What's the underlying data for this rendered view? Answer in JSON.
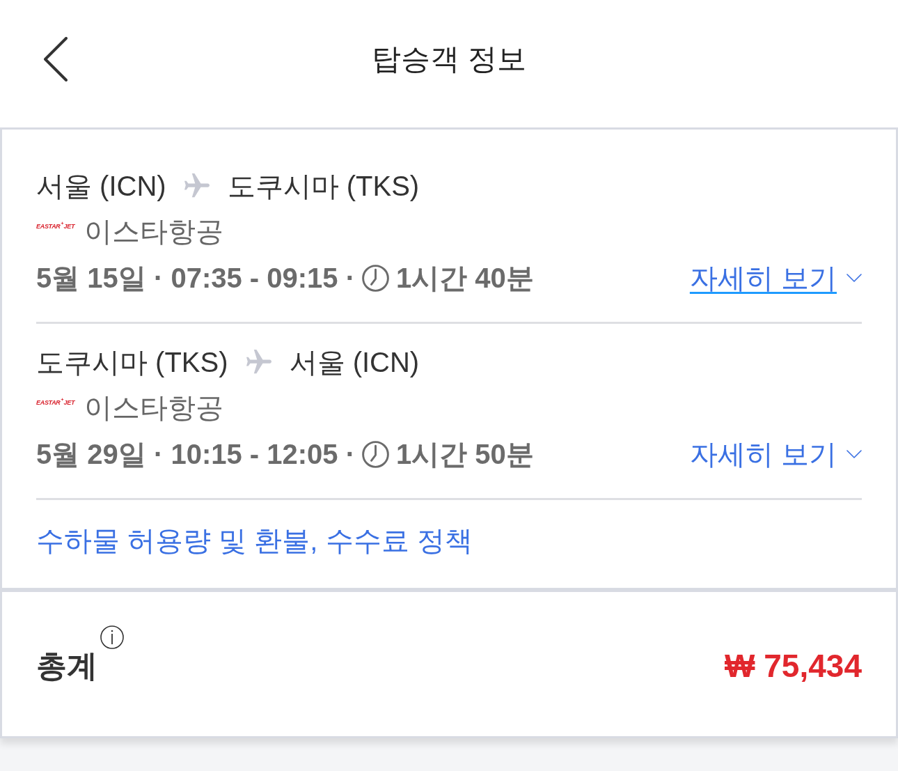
{
  "header": {
    "title": "탑승객 정보"
  },
  "flights": [
    {
      "origin": "서울 (ICN)",
      "destination": "도쿠시마 (TKS)",
      "airline_logo": [
        "EASTAR",
        "JET"
      ],
      "airline": "이스타항공",
      "schedule": "5월 15일 · 07:35 - 09:15 ·",
      "duration": "1시간 40분",
      "details_link": {
        "label": "자세히 보기",
        "focused": true
      }
    },
    {
      "origin": "도쿠시마 (TKS)",
      "destination": "서울 (ICN)",
      "airline_logo": [
        "EASTAR",
        "JET"
      ],
      "airline": "이스타항공",
      "schedule": "5월 29일 · 10:15 - 12:05 ·",
      "duration": "1시간 50분",
      "details_link": {
        "label": "자세히 보기",
        "focused": false
      }
    }
  ],
  "policy_link": "수하물 허용량 및 환불, 수수료 정책",
  "total": {
    "label": "총계",
    "amount": "₩ 75,434"
  }
}
